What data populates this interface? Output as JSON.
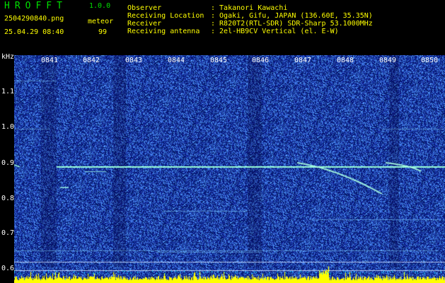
{
  "header": {
    "app_name": "HROFFT",
    "version": "1.0.0",
    "filename": "2504290840.png",
    "mode": "meteor",
    "datetime": "25.04.29 08:40",
    "count": "99"
  },
  "station_info": [
    {
      "label": "Observer",
      "value": ": Takanori Kawachi"
    },
    {
      "label": "Receiving Location",
      "value": ": Ogaki, Gifu, JAPAN (136.60E, 35.35N)"
    },
    {
      "label": "Receiver",
      "value": ": R820T2(RTL-SDR) SDR-Sharp 53.1000MHz"
    },
    {
      "label": "Receiving antenna",
      "value": ": 2el-HB9CV Vertical (el. E-W)"
    }
  ],
  "spectrogram": {
    "unit_label": "kHz",
    "freq_ticks": [
      "1.1",
      "1.0",
      "0.9",
      "0.8",
      "0.7",
      "0.6"
    ],
    "time_ticks": [
      "0841",
      "0842",
      "0843",
      "0844",
      "0845",
      "0846",
      "0847",
      "0848",
      "0849",
      "0850"
    ],
    "colors": {
      "background": "#0a0f7a",
      "noise": "#3c64ff",
      "signal": "#9affd8",
      "bottom_bar": "#ffff00"
    }
  }
}
